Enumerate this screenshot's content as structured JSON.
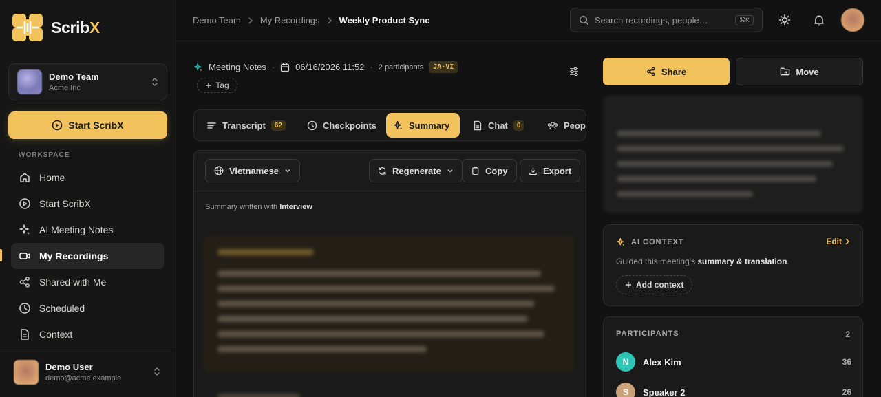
{
  "app": {
    "name_main": "Scrib",
    "name_accent": "X"
  },
  "team": {
    "name": "Demo Team",
    "org": "Acme Inc"
  },
  "start_button": "Start ScribX",
  "sidebar": {
    "section_title": "WORKSPACE",
    "items": [
      {
        "label": "Home",
        "icon": "home-icon"
      },
      {
        "label": "Start ScribX",
        "icon": "play-circle-icon"
      },
      {
        "label": "AI Meeting Notes",
        "icon": "sparkle-icon"
      },
      {
        "label": "My Recordings",
        "icon": "video-icon",
        "active": true
      },
      {
        "label": "Shared with Me",
        "icon": "share-icon"
      },
      {
        "label": "Scheduled",
        "icon": "clock-icon"
      },
      {
        "label": "Context",
        "icon": "document-icon"
      }
    ]
  },
  "user": {
    "name": "Demo User",
    "email": "demo@acme.example"
  },
  "breadcrumb": [
    "Demo Team",
    "My Recordings",
    "Weekly Product Sync"
  ],
  "search": {
    "placeholder": "Search recordings, people…",
    "shortcut": "⌘K"
  },
  "meta": {
    "type": "Meeting Notes",
    "datetime": "06/16/2026 11:52",
    "participants": "2 participants",
    "languages": "JA·VI",
    "tag_label": "Tag"
  },
  "tabs": [
    {
      "label": "Transcript",
      "count": "62"
    },
    {
      "label": "Checkpoints"
    },
    {
      "label": "Summary",
      "active": true
    },
    {
      "label": "Chat",
      "count": "0"
    },
    {
      "label": "People"
    }
  ],
  "toolbar": {
    "language": "Vietnamese",
    "regenerate": "Regenerate",
    "copy": "Copy",
    "export": "Export"
  },
  "summary": {
    "caption_prefix": "Summary written with ",
    "template": "Interview"
  },
  "actions": {
    "share": "Share",
    "move": "Move"
  },
  "ai_context": {
    "title": "AI CONTEXT",
    "edit": "Edit",
    "desc_prefix": "Guided this meeting's ",
    "desc_bold": "summary & translation",
    "desc_suffix": ".",
    "add": "Add context"
  },
  "participants_panel": {
    "title": "PARTICIPANTS",
    "count": "2",
    "people": [
      {
        "initial": "N",
        "name": "Alex Kim",
        "count": "36",
        "color": "#2ec4b6"
      },
      {
        "initial": "S",
        "name": "Speaker 2",
        "count": "26",
        "color": "#c9a27a"
      }
    ]
  },
  "colors": {
    "accent": "#f2c35c",
    "background": "#121212",
    "panel": "#1a1a1a"
  }
}
